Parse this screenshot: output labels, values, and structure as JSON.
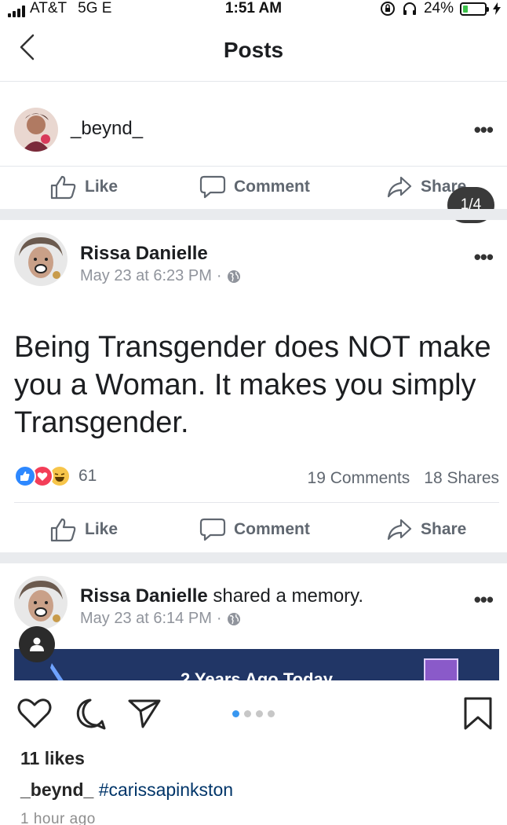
{
  "status_bar": {
    "carrier": "AT&T",
    "network": "5G E",
    "time": "1:51 AM",
    "battery": "24%",
    "battery_level": 0.24
  },
  "nav": {
    "title": "Posts"
  },
  "post1": {
    "author": "_beynd_",
    "actions": {
      "like": "Like",
      "comment": "Comment",
      "share": "Share"
    }
  },
  "badge": "1/4",
  "post2": {
    "author": "Rissa Danielle",
    "timestamp": "May 23 at 6:23 PM",
    "separator": "·",
    "text": "Being Transgender does NOT make you a Woman. It makes you simply Transgender.",
    "reaction_count": "61",
    "comments": "19 Comments",
    "shares": "18 Shares",
    "actions": {
      "like": "Like",
      "comment": "Comment",
      "share": "Share"
    }
  },
  "post3": {
    "author": "Rissa Danielle",
    "action_text": "shared a memory.",
    "timestamp": "May 23 at 6:14 PM",
    "separator": "·",
    "banner_text": "2 Years Ago Today"
  },
  "instagram": {
    "likes": "11 likes",
    "caption_user": "_beynd_",
    "caption_tag": "#carissapinkston",
    "time_ago": "1 hour ago",
    "page_count": 4,
    "active_page": 1
  },
  "colors": {
    "facebook_grey": "#606770",
    "divider": "#e9ebee",
    "memory_banner": "#213666",
    "instagram_link": "#003569",
    "pager_active": "#3897f0"
  }
}
